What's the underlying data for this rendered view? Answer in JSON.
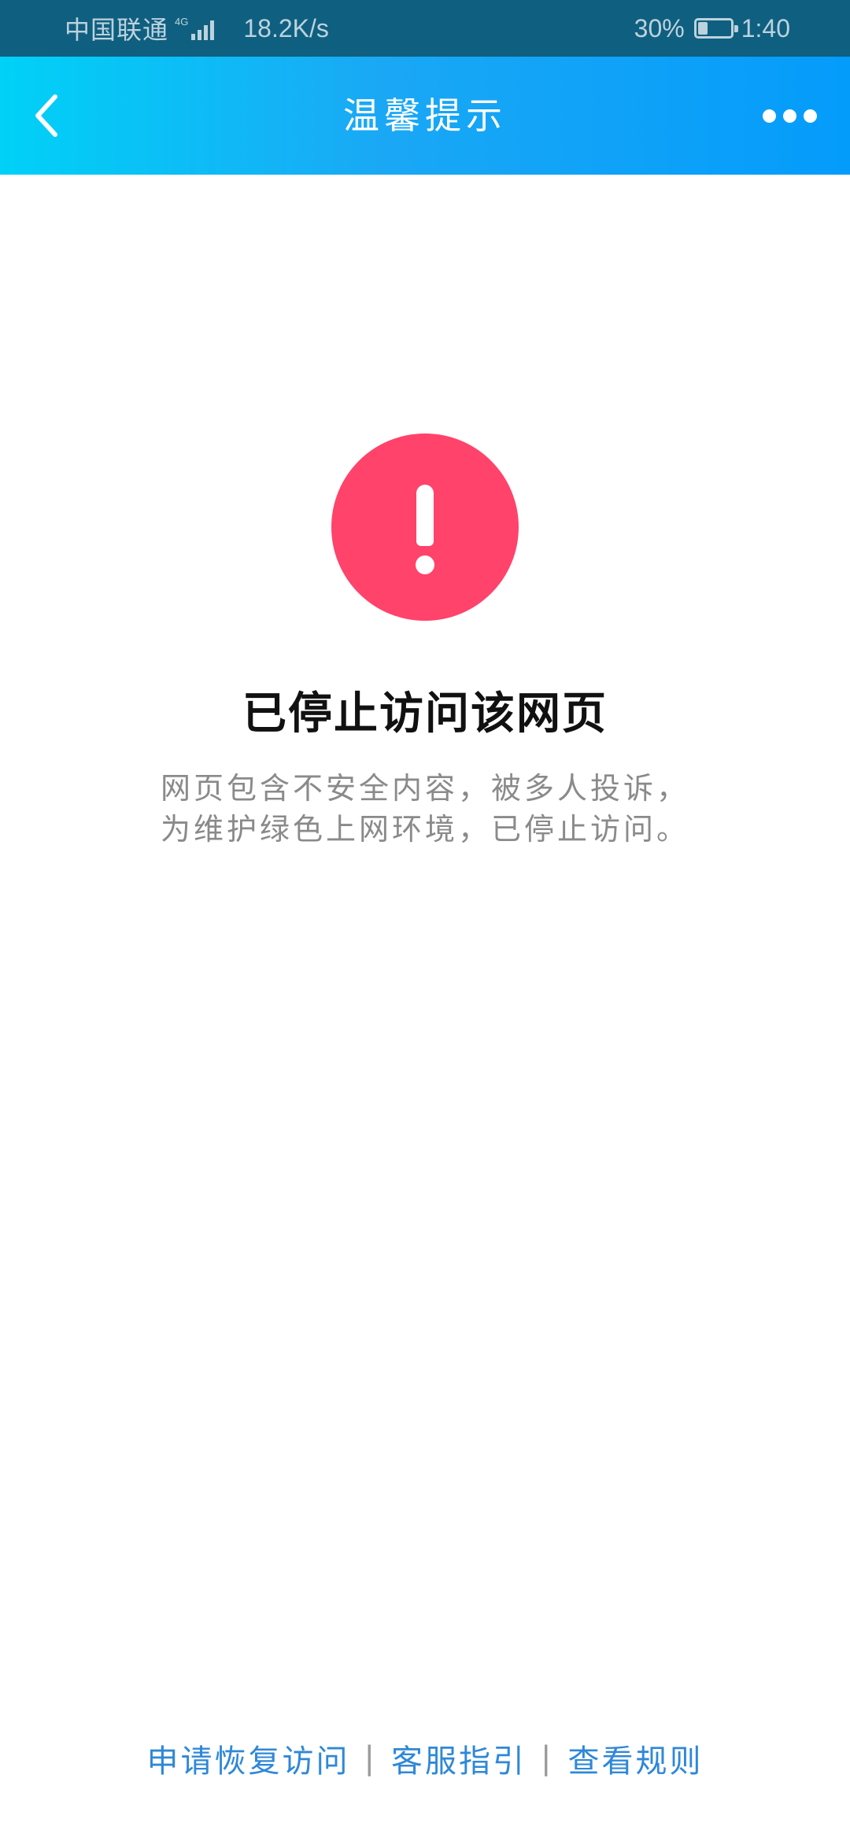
{
  "status_bar": {
    "carrier": "中国联通",
    "network_type": "4G",
    "speed": "18.2K/s",
    "battery_percent": "30%",
    "battery_level": 0.3,
    "time": "1:40"
  },
  "navbar": {
    "title": "温馨提示",
    "back_icon": "chevron-left-icon",
    "more_icon": "more-dots-icon"
  },
  "main": {
    "alert_icon": "exclamation-icon",
    "alert_color": "#ff436b",
    "headline": "已停止访问该网页",
    "description_line1": "网页包含不安全内容，被多人投诉，",
    "description_line2": "为维护绿色上网环境，已停止访问。"
  },
  "footer": {
    "link1": "申请恢复访问",
    "link2": "客服指引",
    "link3": "查看规则",
    "separator": "|",
    "link_color": "#2f88d8"
  },
  "colors": {
    "nav_gradient_start": "#00d1f7",
    "nav_gradient_end": "#049cfb",
    "status_bar_bg": "#0f5f80"
  }
}
